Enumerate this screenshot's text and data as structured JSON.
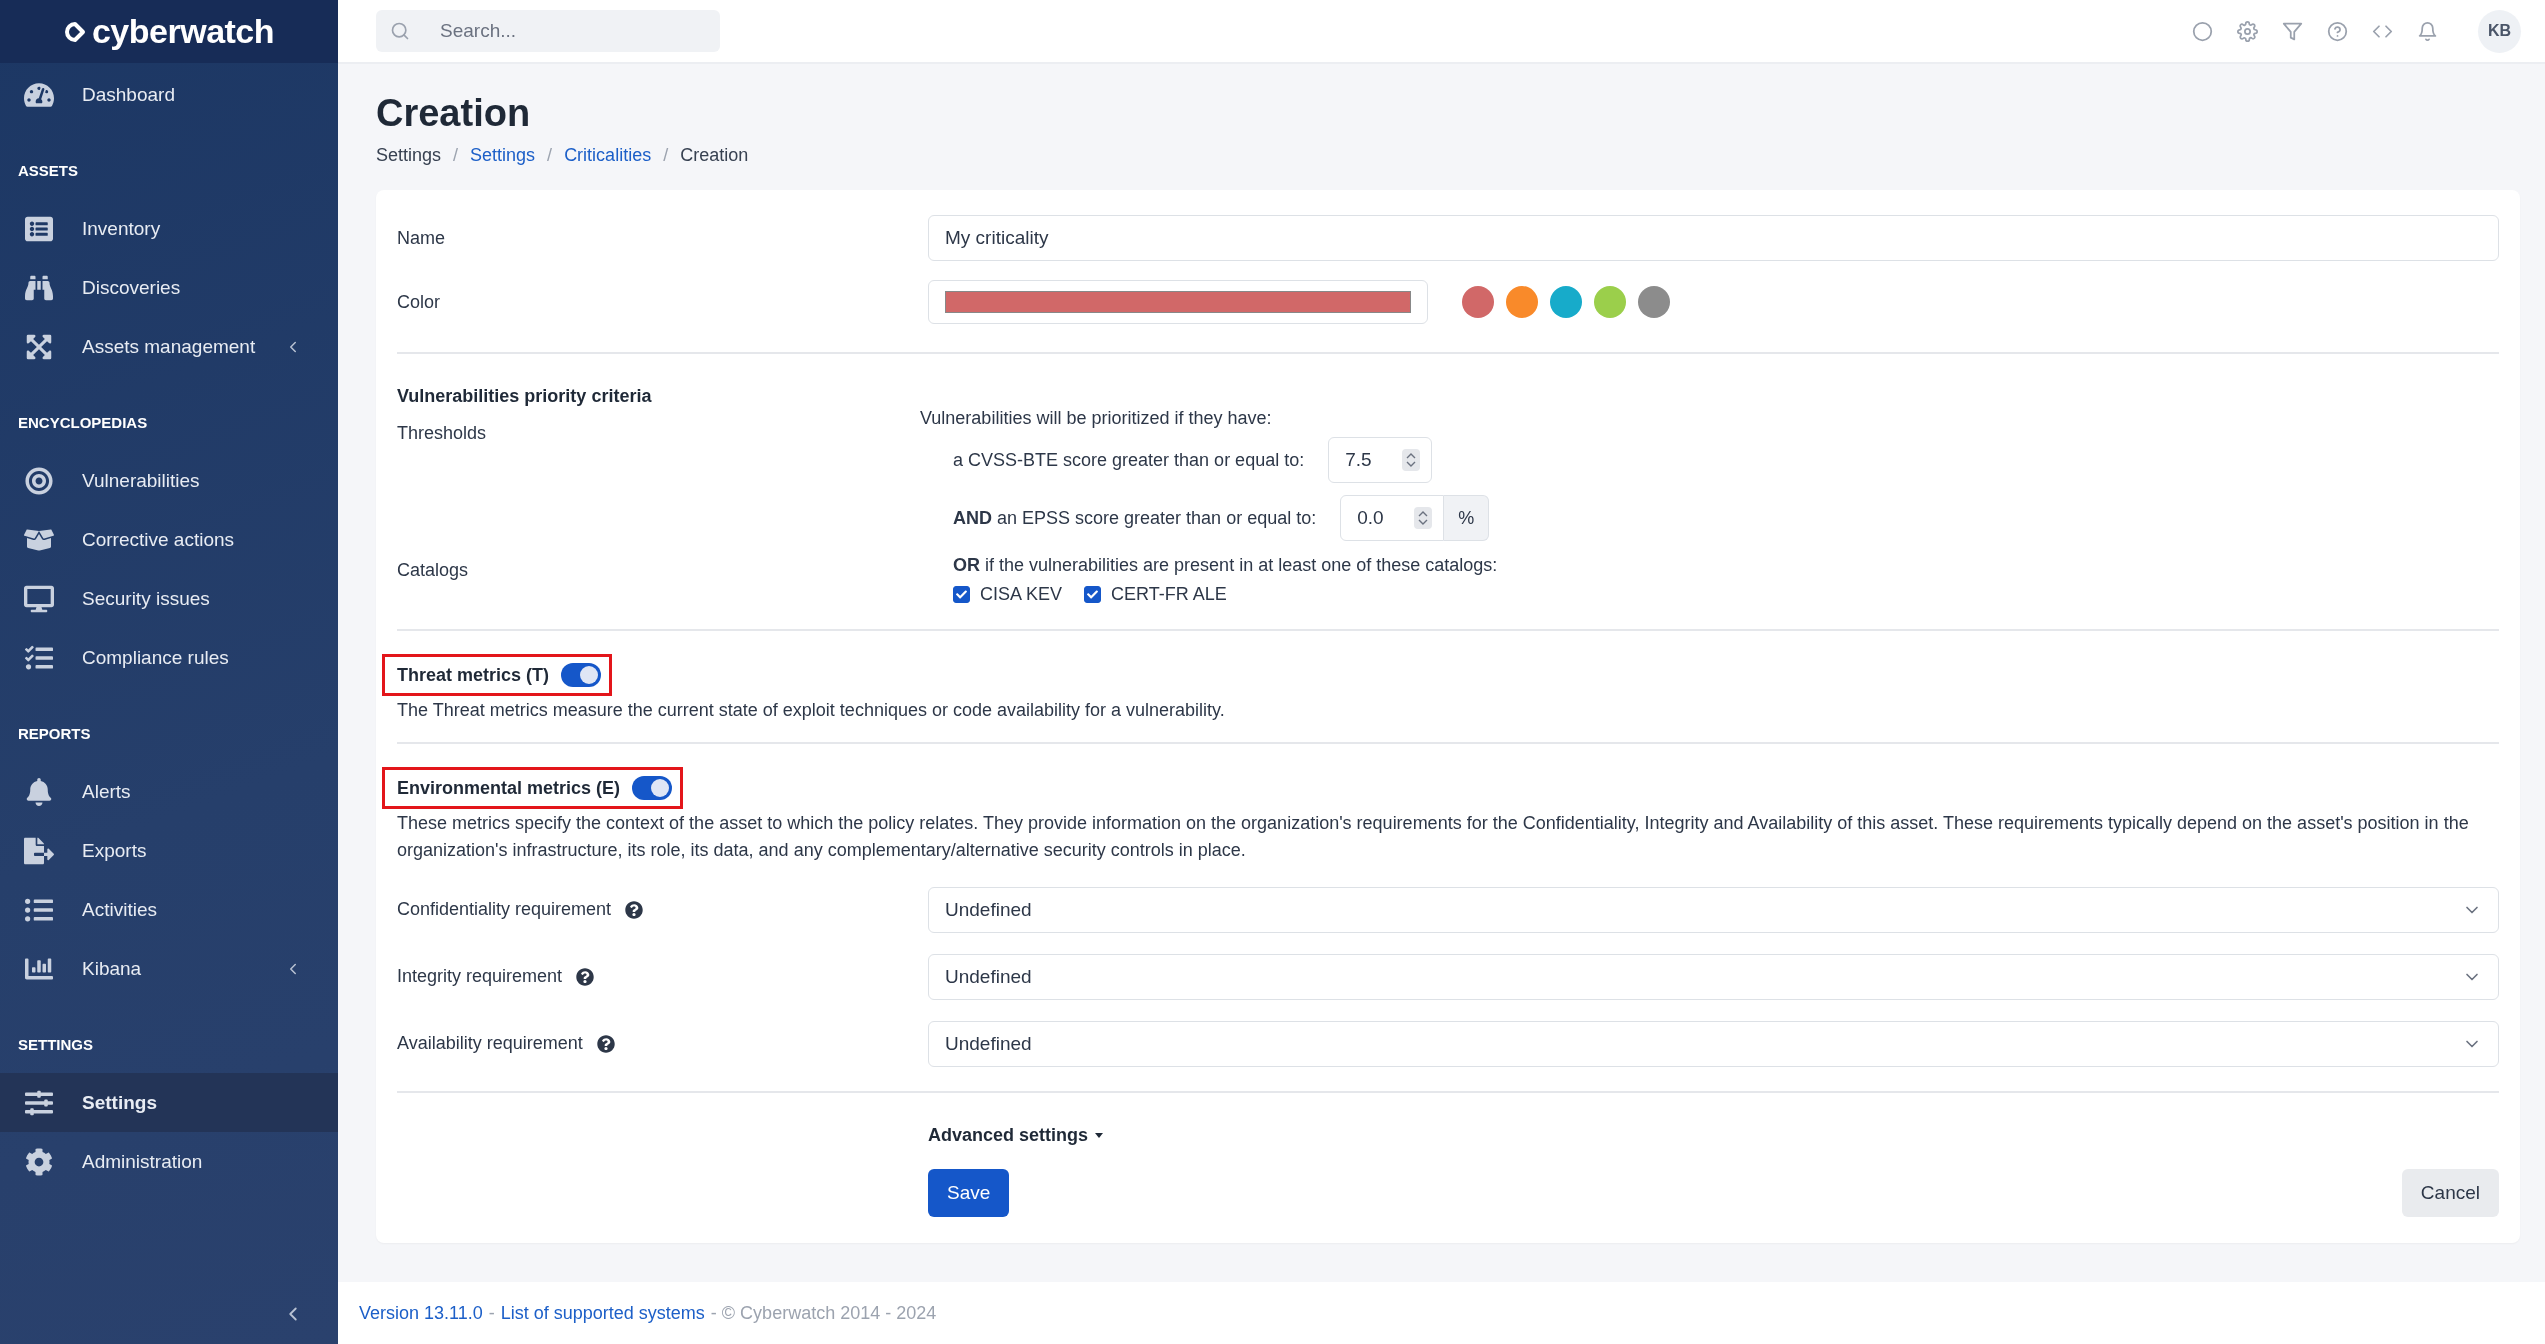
{
  "sidebar": {
    "logo": "cyberwatch",
    "sections": [
      {
        "items": [
          {
            "label": "Dashboard",
            "selected": false,
            "has_submenu": false
          }
        ]
      },
      {
        "heading": "ASSETS",
        "items": [
          {
            "label": "Inventory",
            "selected": false,
            "has_submenu": false
          },
          {
            "label": "Discoveries",
            "selected": false,
            "has_submenu": false
          },
          {
            "label": "Assets management",
            "selected": false,
            "has_submenu": true
          }
        ]
      },
      {
        "heading": "ENCYCLOPEDIAS",
        "items": [
          {
            "label": "Vulnerabilities",
            "selected": false,
            "has_submenu": false
          },
          {
            "label": "Corrective actions",
            "selected": false,
            "has_submenu": false
          },
          {
            "label": "Security issues",
            "selected": false,
            "has_submenu": false
          },
          {
            "label": "Compliance rules",
            "selected": false,
            "has_submenu": false
          }
        ]
      },
      {
        "heading": "REPORTS",
        "items": [
          {
            "label": "Alerts",
            "selected": false,
            "has_submenu": false
          },
          {
            "label": "Exports",
            "selected": false,
            "has_submenu": false
          },
          {
            "label": "Activities",
            "selected": false,
            "has_submenu": false
          },
          {
            "label": "Kibana",
            "selected": false,
            "has_submenu": true
          }
        ]
      },
      {
        "heading": "SETTINGS",
        "items": [
          {
            "label": "Settings",
            "selected": true,
            "has_submenu": false
          },
          {
            "label": "Administration",
            "selected": false,
            "has_submenu": false
          }
        ]
      }
    ]
  },
  "topbar": {
    "search": {
      "placeholder": "Search..."
    },
    "avatar": "KB"
  },
  "page": {
    "title": "Creation",
    "separator": "/",
    "breadcrumb": [
      {
        "label": "Settings",
        "link": false
      },
      {
        "label": "Settings",
        "link": true
      },
      {
        "label": "Criticalities",
        "link": true
      },
      {
        "label": "Creation",
        "link": false
      }
    ]
  },
  "form": {
    "name": {
      "label": "Name",
      "value": "My criticality"
    },
    "color": {
      "label": "Color",
      "color": "#d16868",
      "swatches": [
        {
          "color": "#d16868"
        },
        {
          "color": "#f98a2a"
        },
        {
          "color": "#17abca"
        },
        {
          "color": "#9bcf4b"
        },
        {
          "color": "#8c8c8c"
        }
      ]
    },
    "criteria": {
      "heading": "Vulnerabilities priority criteria",
      "thresholds_label": "Thresholds",
      "intro": "Vulnerabilities will be prioritized if they have:",
      "cvss": {
        "label": "a CVSS-BTE score greater than or equal to:",
        "value": "7.5"
      },
      "epss": {
        "label": "**AND** an EPSS score greater than or equal to:",
        "value": "0.0",
        "unit": "%"
      },
      "catalogs_label": "Catalogs",
      "catalogs_intro": "**OR** if the vulnerabilities are present in at least one of these catalogs:",
      "catalogs": [
        {
          "label": "CISA KEV",
          "checked": true
        },
        {
          "label": "CERT-FR ALE",
          "checked": true
        }
      ]
    },
    "metrics": [
      {
        "title": "Threat metrics (T)",
        "on": true,
        "highlighted": true,
        "description": "The Threat metrics measure the current state of exploit techniques or code availability for a vulnerability."
      },
      {
        "title": "Environmental metrics (E)",
        "on": true,
        "highlighted": true,
        "description": "These metrics specify the context of the asset to which the policy relates. They provide information on the organization's requirements for the Confidentiality, Integrity and Availability of this asset. These requirements typically depend on the asset's position in the organization's infrastructure, its role, its data, and any complementary/alternative security controls in place."
      }
    ],
    "requirements": [
      {
        "label": "Confidentiality requirement",
        "value": "Undefined"
      },
      {
        "label": "Integrity requirement",
        "value": "Undefined"
      },
      {
        "label": "Availability requirement",
        "value": "Undefined"
      }
    ],
    "advanced": "Advanced settings",
    "save": "Save",
    "cancel": "Cancel"
  },
  "footer": [
    {
      "text": "Version 13.11.0",
      "link": true
    },
    {
      "text": "-",
      "link": false
    },
    {
      "text": "List of supported systems",
      "link": true
    },
    {
      "text": "- © Cyberwatch 2014 - 2024",
      "link": false
    }
  ]
}
